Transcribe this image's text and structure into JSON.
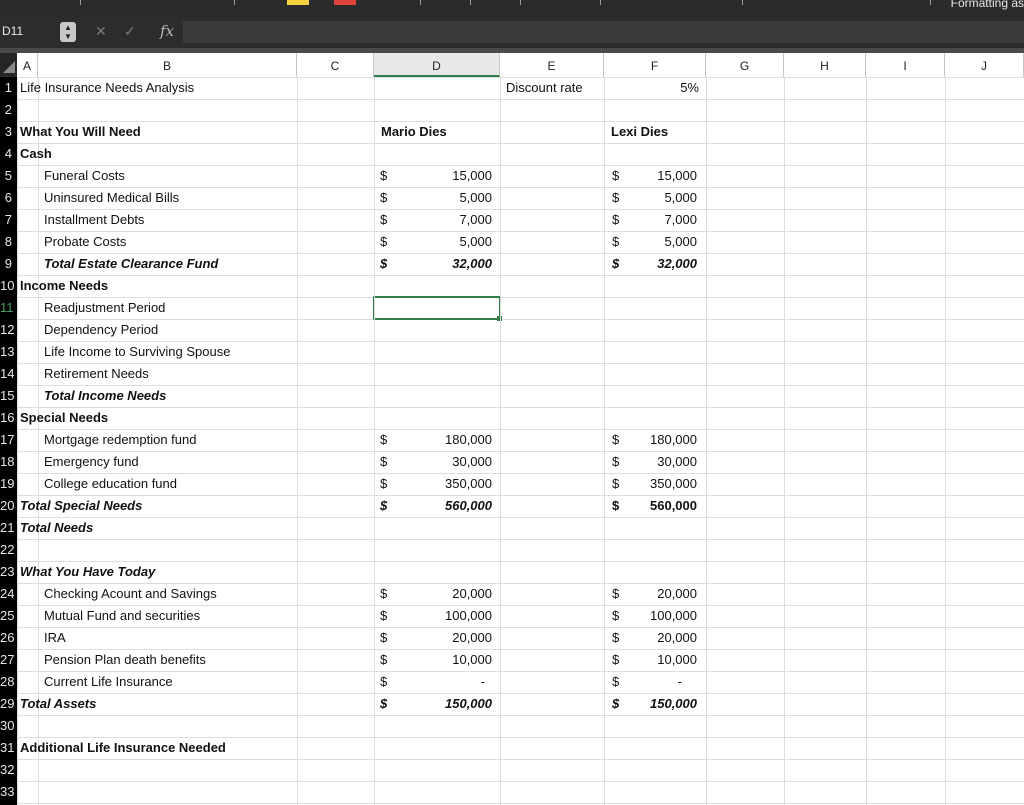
{
  "toolbar": {
    "label": "Formatting  as"
  },
  "formula_bar": {
    "name_box": "D11",
    "cancel": "✕",
    "enter": "✓",
    "fx": "fx",
    "content": ""
  },
  "columns": [
    "A",
    "B",
    "C",
    "D",
    "E",
    "F",
    "G",
    "H",
    "I",
    "J"
  ],
  "selected_column": "D",
  "selected_row": 11,
  "rows": [
    "1",
    "2",
    "3",
    "4",
    "5",
    "6",
    "7",
    "8",
    "9",
    "10",
    "11",
    "12",
    "13",
    "14",
    "15",
    "16",
    "17",
    "18",
    "19",
    "20",
    "21",
    "22",
    "23",
    "24",
    "25",
    "26",
    "27",
    "28",
    "29",
    "30",
    "31",
    "32",
    "33"
  ],
  "cells": {
    "title": "Life Insurance Needs Analysis",
    "discount_label": "Discount rate",
    "discount_value": "5%",
    "need_header": "What You Will Need",
    "mario_header": "Mario Dies",
    "lexi_header": "Lexi Dies",
    "cash": "Cash",
    "funeral": "Funeral Costs",
    "medical": "Uninsured Medical Bills",
    "installment": "Installment Debts",
    "probate": "Probate Costs",
    "total_estate": "Total Estate Clearance Fund",
    "income_needs": "Income Needs",
    "readjustment": "Readjustment Period",
    "dependency": "Dependency Period",
    "life_income": "Life Income to Surviving Spouse",
    "retirement": "Retirement Needs",
    "total_income": "Total Income Needs",
    "special_needs": "Special Needs",
    "mortgage": "Mortgage redemption fund",
    "emergency": "Emergency fund",
    "college": "College education fund",
    "total_special": "Total Special Needs",
    "total_needs": "Total Needs",
    "have_today": "What You Have Today",
    "checking": "Checking Acount and Savings",
    "mutual": "Mutual Fund and securities",
    "ira": "IRA",
    "pension": "Pension Plan death benefits",
    "current_life": "Current Life Insurance",
    "total_assets": "Total Assets",
    "additional": "Additional Life Insurance Needed",
    "currency": "$",
    "mario": {
      "funeral": "15,000",
      "medical": "5,000",
      "installment": "7,000",
      "probate": "5,000",
      "total_estate": "32,000",
      "mortgage": "180,000",
      "emergency": "30,000",
      "college": "350,000",
      "total_special": "560,000",
      "checking": "20,000",
      "mutual": "100,000",
      "ira": "20,000",
      "pension": "10,000",
      "current_life": "-",
      "total_assets": "150,000"
    },
    "lexi": {
      "funeral": "15,000",
      "medical": "5,000",
      "installment": "7,000",
      "probate": "5,000",
      "total_estate": "32,000",
      "mortgage": "180,000",
      "emergency": "30,000",
      "college": "350,000",
      "total_special": "560,000",
      "checking": "20,000",
      "mutual": "100,000",
      "ira": "20,000",
      "pension": "10,000",
      "current_life": "-",
      "total_assets": "150,000"
    }
  }
}
